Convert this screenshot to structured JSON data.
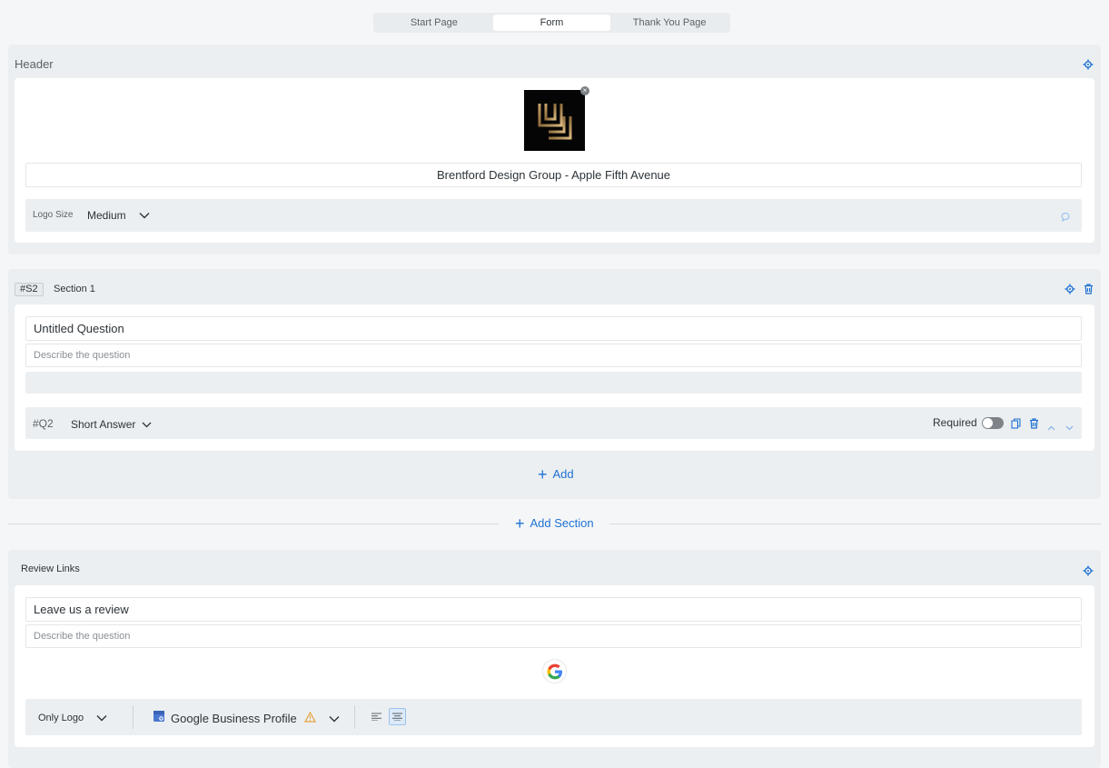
{
  "tabs": [
    {
      "label": "Start Page"
    },
    {
      "label": "Form"
    },
    {
      "label": "Thank You Page"
    }
  ],
  "header": {
    "title": "Header",
    "business_name": "Brentford Design Group - Apple Fifth Avenue",
    "logo_size_label": "Logo Size",
    "logo_size_value": "Medium"
  },
  "section": {
    "id_badge": "#S2",
    "name": "Section 1",
    "question_title": "Untitled Question",
    "question_desc_placeholder": "Describe the question",
    "question_id": "#Q2",
    "question_type": "Short Answer",
    "required_label": "Required",
    "add_label": "Add"
  },
  "add_section_label": "Add Section",
  "review": {
    "title": "Review Links",
    "question_title": "Leave us a review",
    "question_desc_placeholder": "Describe the question",
    "display_mode": "Only Logo",
    "platform": "Google Business Profile"
  },
  "colors": {
    "accent": "#1f72d3",
    "warning": "#e6a23c"
  }
}
